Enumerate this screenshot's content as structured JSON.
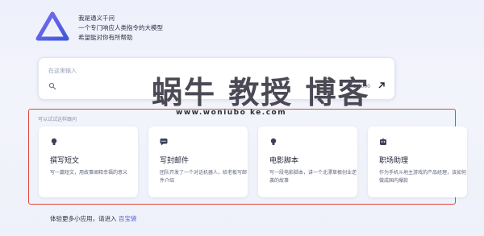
{
  "intro": {
    "line1": "我是通义千问",
    "line2": "一个专门响应人类指令的大模型",
    "line3": "希望能对你有所帮助"
  },
  "prompt": {
    "placeholder": "在这里输入",
    "count": "0",
    "max": "/1000"
  },
  "watermark": {
    "title": "蜗牛 教授 博客",
    "url": "www.woniubo ke.com"
  },
  "suggestions": {
    "title": "可以试试这样跟问",
    "cards": [
      {
        "title": "撰写短文",
        "desc": "写一篇短文，用故事阐释幸福的意义"
      },
      {
        "title": "写封邮件",
        "desc": "团队开发了一个对话机器人，给老板写邮件介绍"
      },
      {
        "title": "电影脚本",
        "desc": "写一段电影脚本，讲一个北漂草根创业逆袭的故事"
      },
      {
        "title": "职场助理",
        "desc": "作为手机斗地主游戏的产品经理，该如何做成国内爆款"
      }
    ]
  },
  "footer": {
    "text": "体验更多小应用，请进入",
    "link": "百宝袋"
  },
  "colors": {
    "accent": "#4b5bd6",
    "highlight_frame": "#e0463a"
  }
}
